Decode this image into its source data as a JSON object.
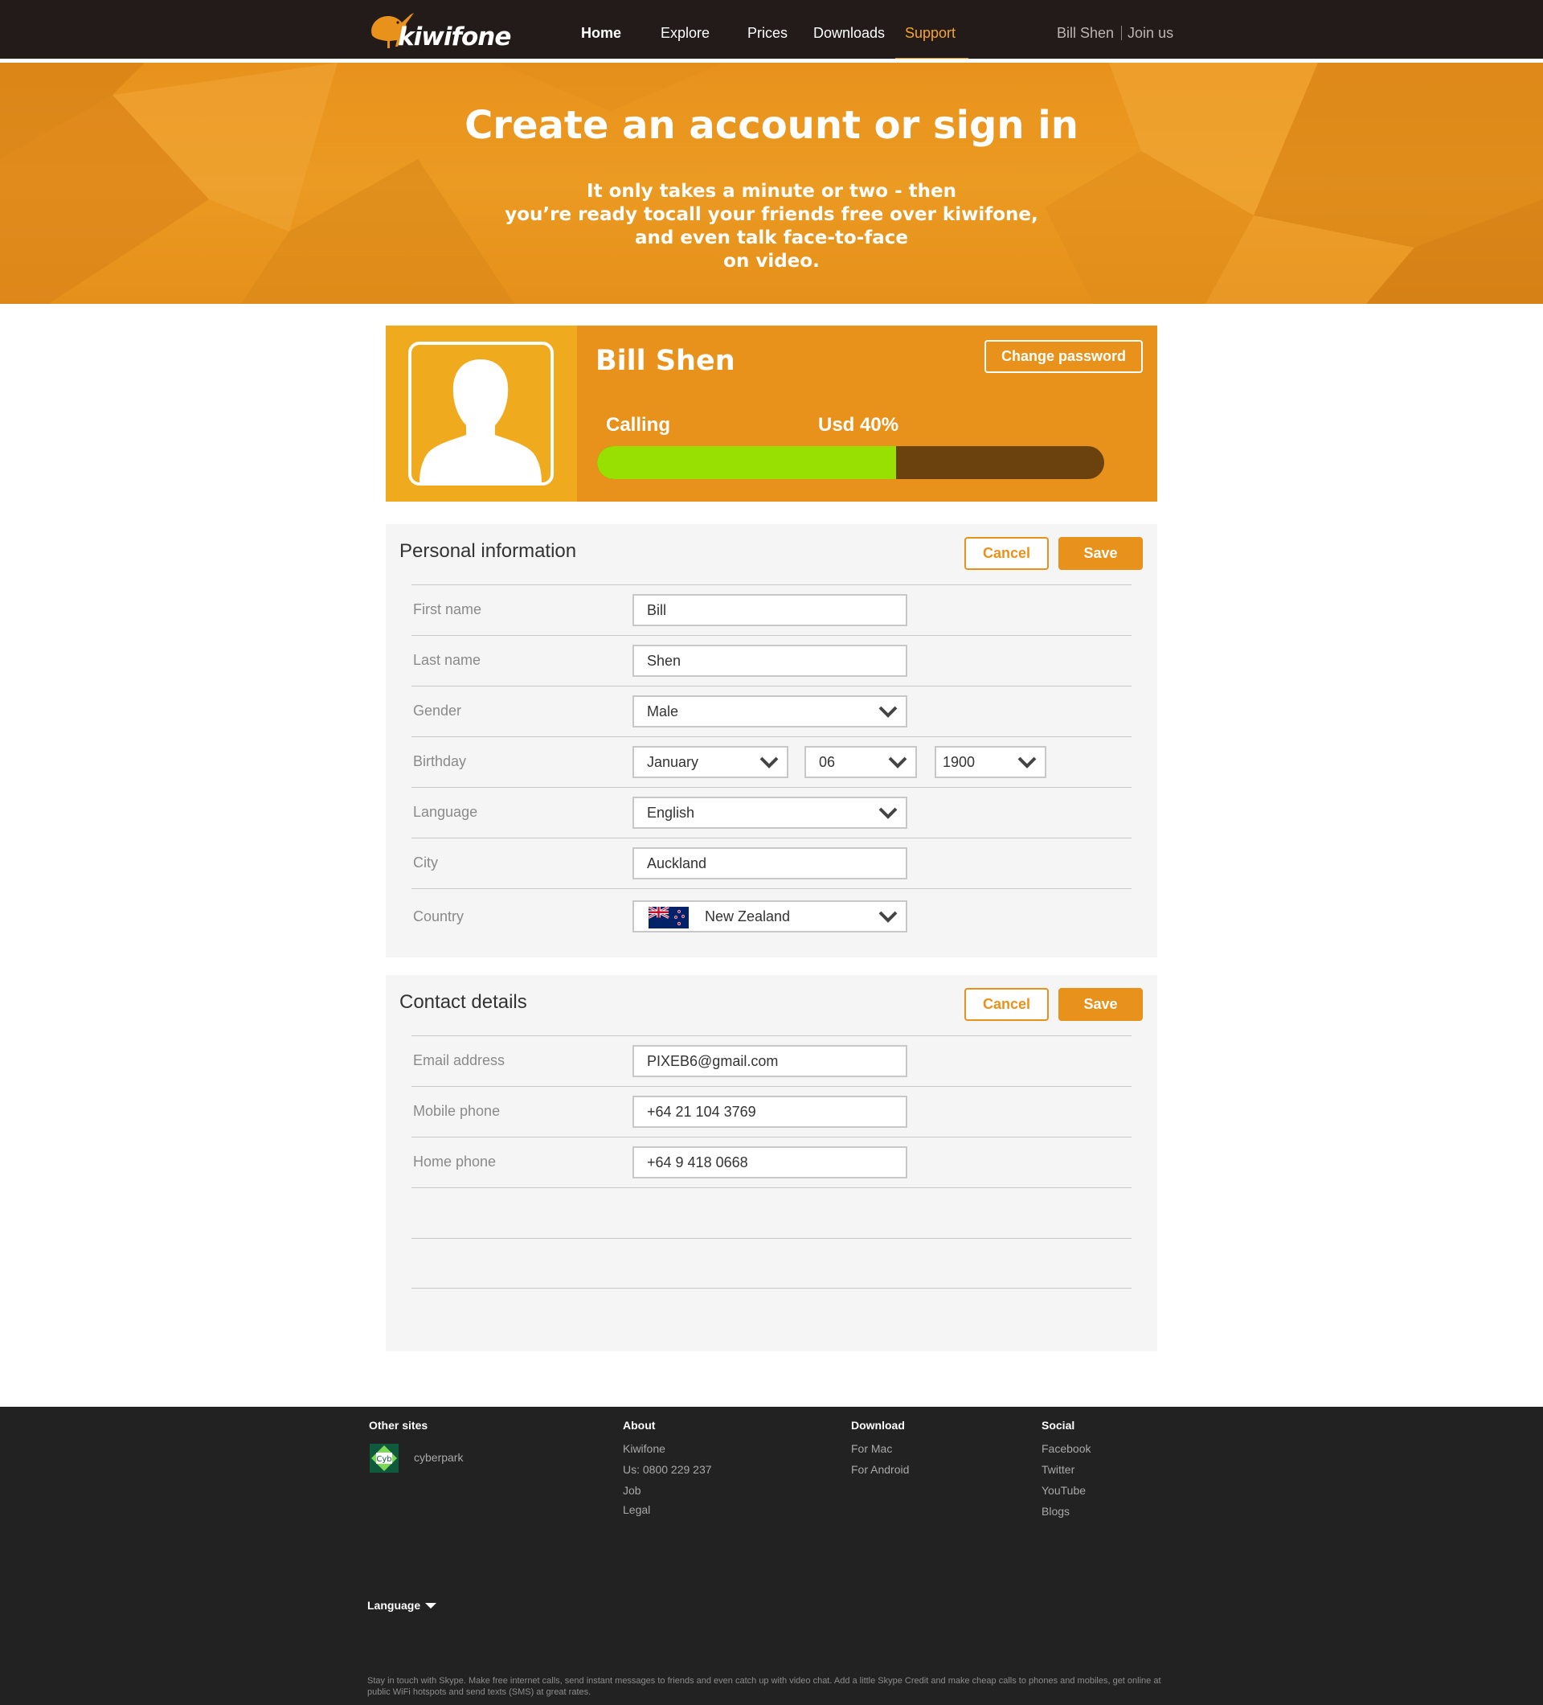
{
  "header": {
    "logo_text": "kiwifone",
    "nav": [
      {
        "label": "Home",
        "active": false
      },
      {
        "label": "Explore",
        "active": false
      },
      {
        "label": "Prices",
        "active": false
      },
      {
        "label": "Downloads",
        "active": false
      },
      {
        "label": "Support",
        "active": true
      }
    ],
    "user_name": "Bill Shen",
    "join_label": "Join us"
  },
  "hero": {
    "title": "Create an account or sign in",
    "subtitle_lines": [
      "It only takes a minute or two - then",
      "you’re ready tocall your friends free over kiwifone,",
      "and even talk face-to-face",
      "on video."
    ]
  },
  "profile": {
    "name": "Bill Shen",
    "change_password_label": "Change password",
    "calling_label": "Calling",
    "usage_label": "Usd 40%",
    "usage_fraction": 0.59
  },
  "personal": {
    "title": "Personal information",
    "cancel_label": "Cancel",
    "save_label": "Save",
    "first_name_label": "First name",
    "first_name": "Bill",
    "last_name_label": "Last name",
    "last_name": "Shen",
    "gender_label": "Gender",
    "gender": "Male",
    "birthday_label": "Birthday",
    "birth_month": "January",
    "birth_day": "06",
    "birth_year": "1900",
    "language_label": "Language",
    "language": "English",
    "city_label": "City",
    "city": "Auckland",
    "country_label": "Country",
    "country": "New Zealand"
  },
  "contact": {
    "title": "Contact details",
    "cancel_label": "Cancel",
    "save_label": "Save",
    "email_label": "Email address",
    "email": "PIXEB6@gmail.com",
    "mobile_label": "Mobile phone",
    "mobile": "+64 21 104 3769",
    "home_label": "Home phone",
    "home": "+64 9 418 0668"
  },
  "footer": {
    "other_sites_title": "Other sites",
    "other_site_name": "cyberpark",
    "other_site_logo_text": "Cyb",
    "about_title": "About",
    "about_links": [
      "Kiwifone",
      "Us: 0800 229 237",
      "Job",
      "Legal"
    ],
    "download_title": "Download",
    "download_links": [
      "For Mac",
      "For Android"
    ],
    "social_title": "Social",
    "social_links": [
      "Facebook",
      "Twitter",
      "YouTube",
      "Blogs"
    ],
    "language_label": "Language",
    "note": "Stay in touch with Skype. Make free internet calls, send instant messages to friends and even catch up with video chat. Add a little Skype Credit and make cheap calls to phones and mobiles, get online at public WiFi hotspots and send texts (SMS) at great rates."
  },
  "colors": {
    "accent": "#e8921c",
    "topbar": "#231b19",
    "progress_fill": "#97e002",
    "progress_track": "#6b420e",
    "footer_bg": "#222222"
  }
}
